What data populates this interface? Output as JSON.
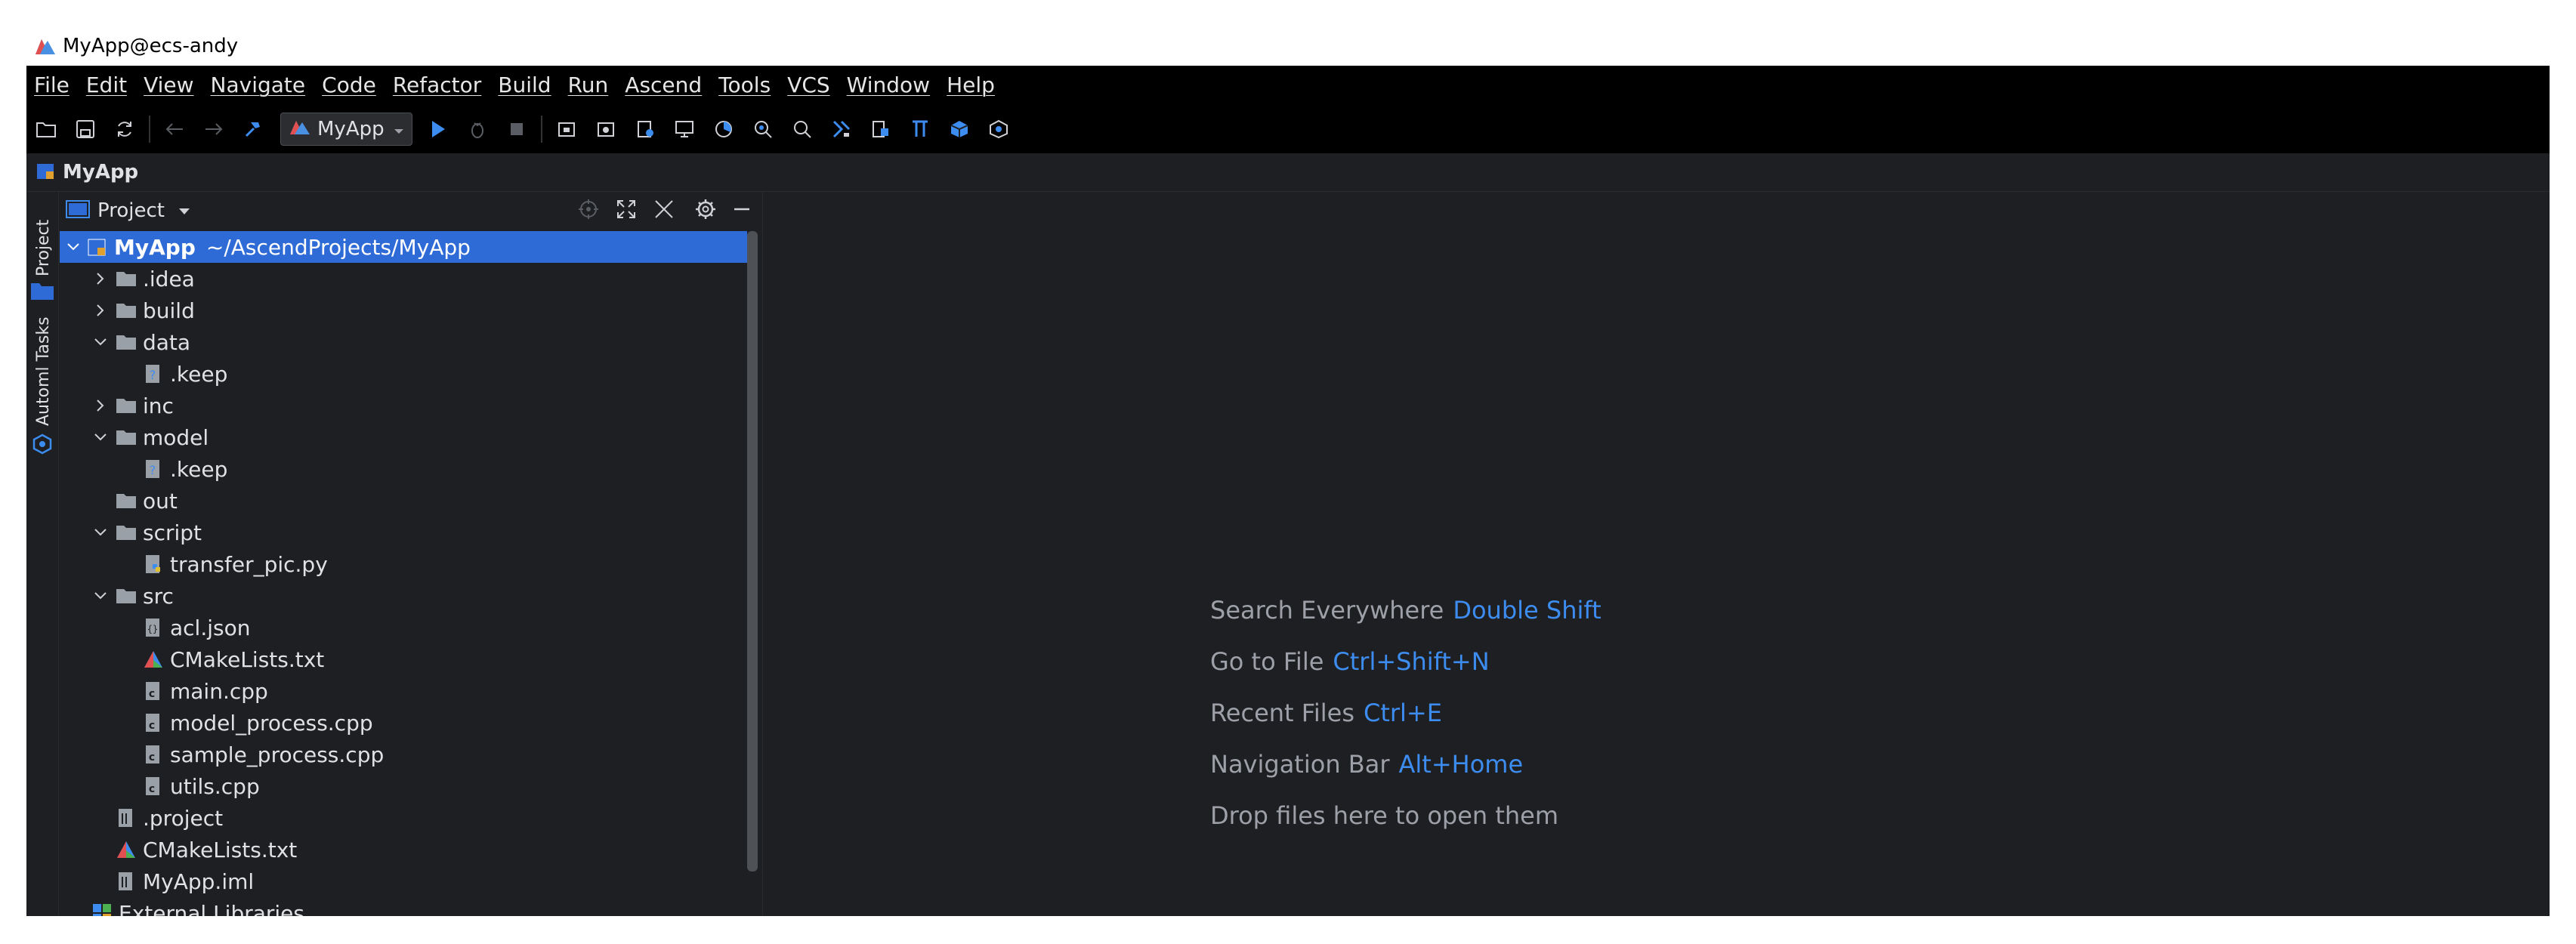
{
  "window": {
    "title": "MyApp@ecs-andy"
  },
  "menu": [
    "File",
    "Edit",
    "View",
    "Navigate",
    "Code",
    "Refactor",
    "Build",
    "Run",
    "Ascend",
    "Tools",
    "VCS",
    "Window",
    "Help"
  ],
  "toolbar": {
    "run_config": "MyApp"
  },
  "navbar": {
    "project": "MyApp"
  },
  "tool_strip": {
    "project_tab": "Project",
    "tasks_tab": "Automl Tasks"
  },
  "panel": {
    "title": "Project"
  },
  "tree": [
    {
      "name": "MyApp",
      "path": "~/AscendProjects/MyApp"
    },
    {
      "name": ".idea"
    },
    {
      "name": "build"
    },
    {
      "name": "data"
    },
    {
      "name": ".keep"
    },
    {
      "name": "inc"
    },
    {
      "name": "model"
    },
    {
      "name": ".keep"
    },
    {
      "name": "out"
    },
    {
      "name": "script"
    },
    {
      "name": "transfer_pic.py"
    },
    {
      "name": "src"
    },
    {
      "name": "acl.json"
    },
    {
      "name": "CMakeLists.txt"
    },
    {
      "name": "main.cpp"
    },
    {
      "name": "model_process.cpp"
    },
    {
      "name": "sample_process.cpp"
    },
    {
      "name": "utils.cpp"
    },
    {
      "name": ".project"
    },
    {
      "name": "CMakeLists.txt"
    },
    {
      "name": "MyApp.iml"
    },
    {
      "name": "External Libraries"
    }
  ],
  "hints": [
    {
      "label": "Search Everywhere",
      "key": "Double Shift"
    },
    {
      "label": "Go to File",
      "key": "Ctrl+Shift+N"
    },
    {
      "label": "Recent Files",
      "key": "Ctrl+E"
    },
    {
      "label": "Navigation Bar",
      "key": "Alt+Home"
    },
    {
      "label": "Drop files here to open them",
      "key": ""
    }
  ],
  "colors": {
    "accent": "#2e6bd6",
    "link": "#3d8cf0",
    "background": "#1e1f22",
    "menubar": "#000000"
  }
}
